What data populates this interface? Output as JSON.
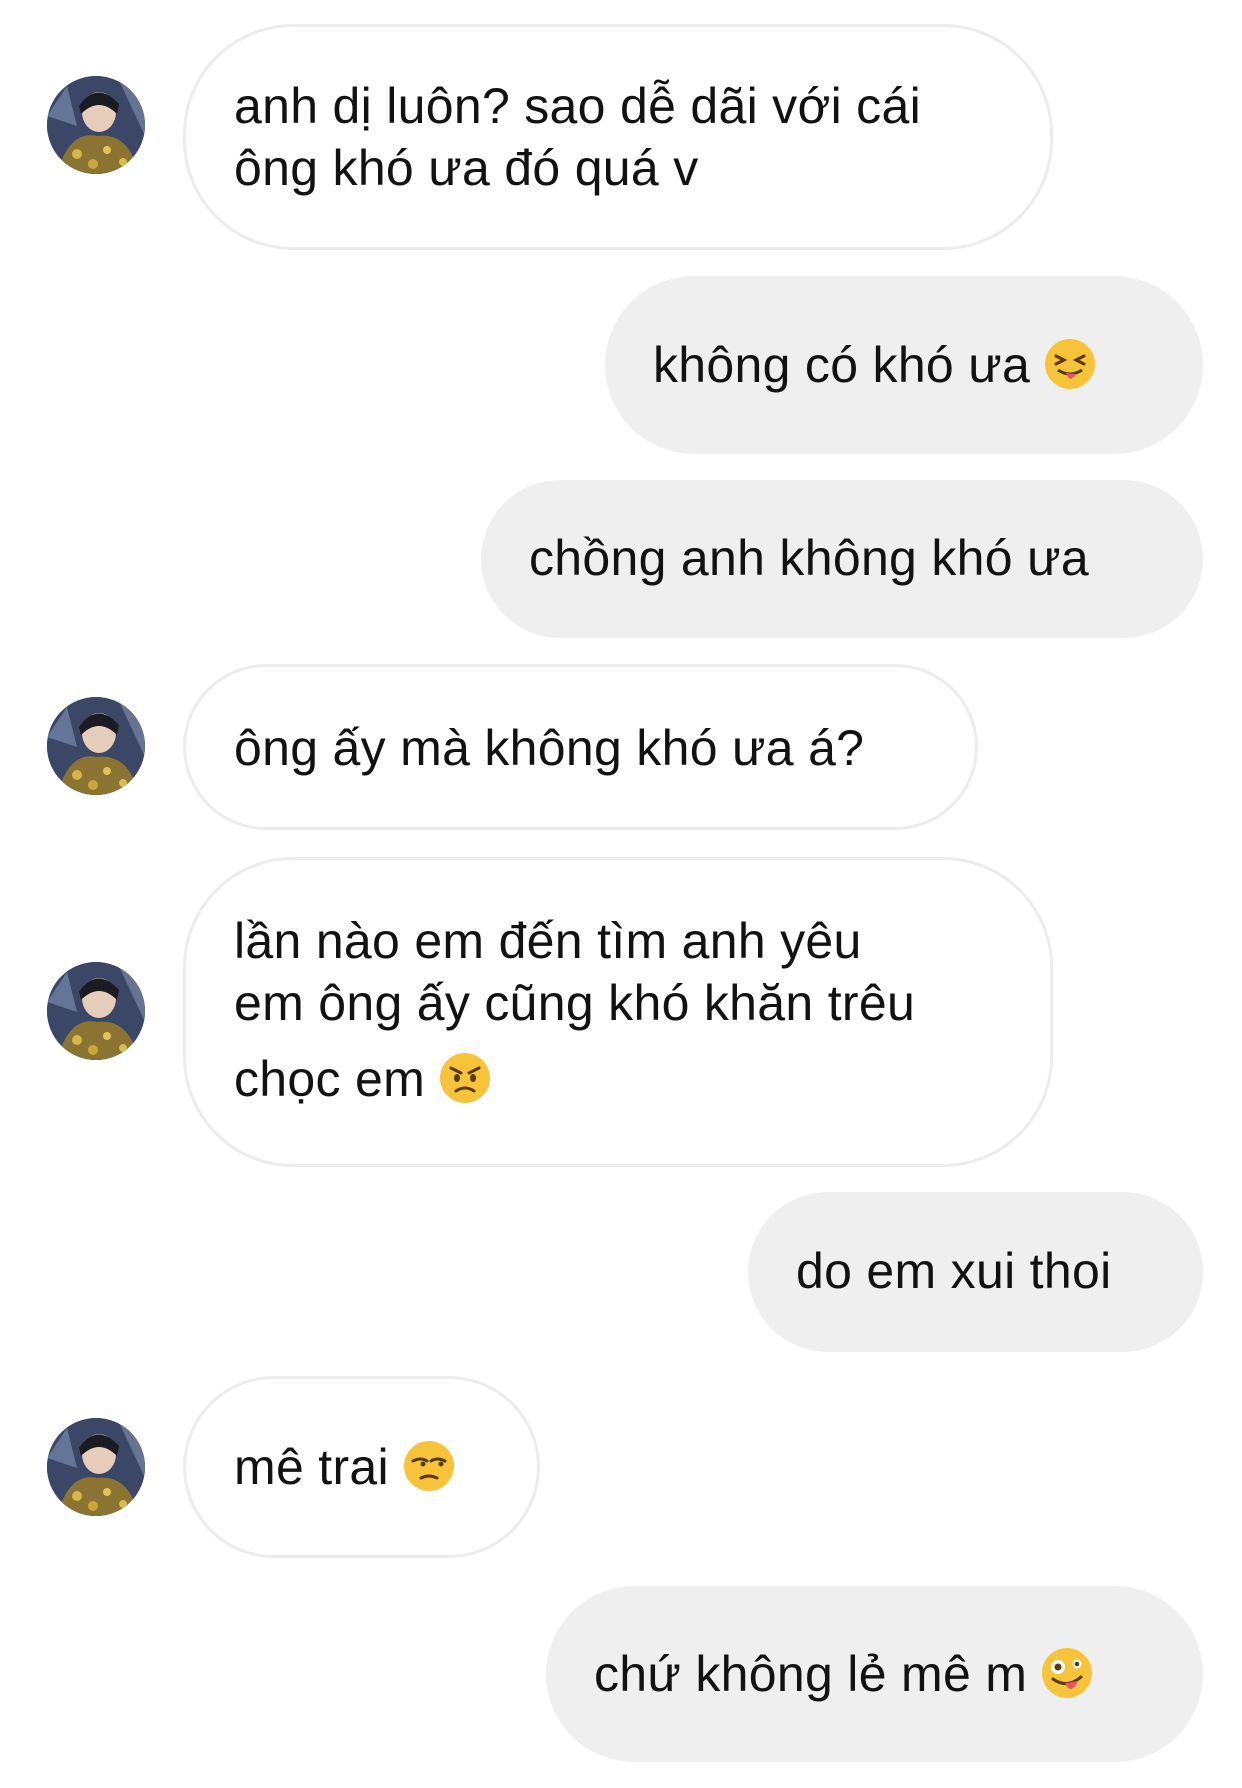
{
  "conversation": {
    "messages": [
      {
        "direction": "received",
        "lines": [
          "anh dị luôn? sao dễ dãi với cái",
          "ông khó ưa đó quá v"
        ]
      },
      {
        "direction": "sent",
        "text": "không có khó ưa",
        "emoji": "squinting-face-with-tongue-icon"
      },
      {
        "direction": "sent",
        "text": "chồng anh không khó ưa"
      },
      {
        "direction": "received",
        "text": "ông ấy mà không khó ưa á?"
      },
      {
        "direction": "received",
        "lines": [
          "lần nào em đến tìm anh yêu",
          "em ông ấy cũng khó khăn trêu",
          "chọc em"
        ],
        "emoji": "angry-face-icon"
      },
      {
        "direction": "sent",
        "text": "do em xui thoi"
      },
      {
        "direction": "received",
        "text": "mê trai",
        "emoji": "unamused-face-icon"
      },
      {
        "direction": "sent",
        "text": "chứ không lẻ mê m",
        "emoji": "zany-face-icon"
      }
    ]
  },
  "colors": {
    "received_bubble": "#ffffff",
    "received_border": "#ececec",
    "sent_bubble": "#efefef",
    "text": "#121212",
    "emoji_face": "#f7c33a"
  }
}
